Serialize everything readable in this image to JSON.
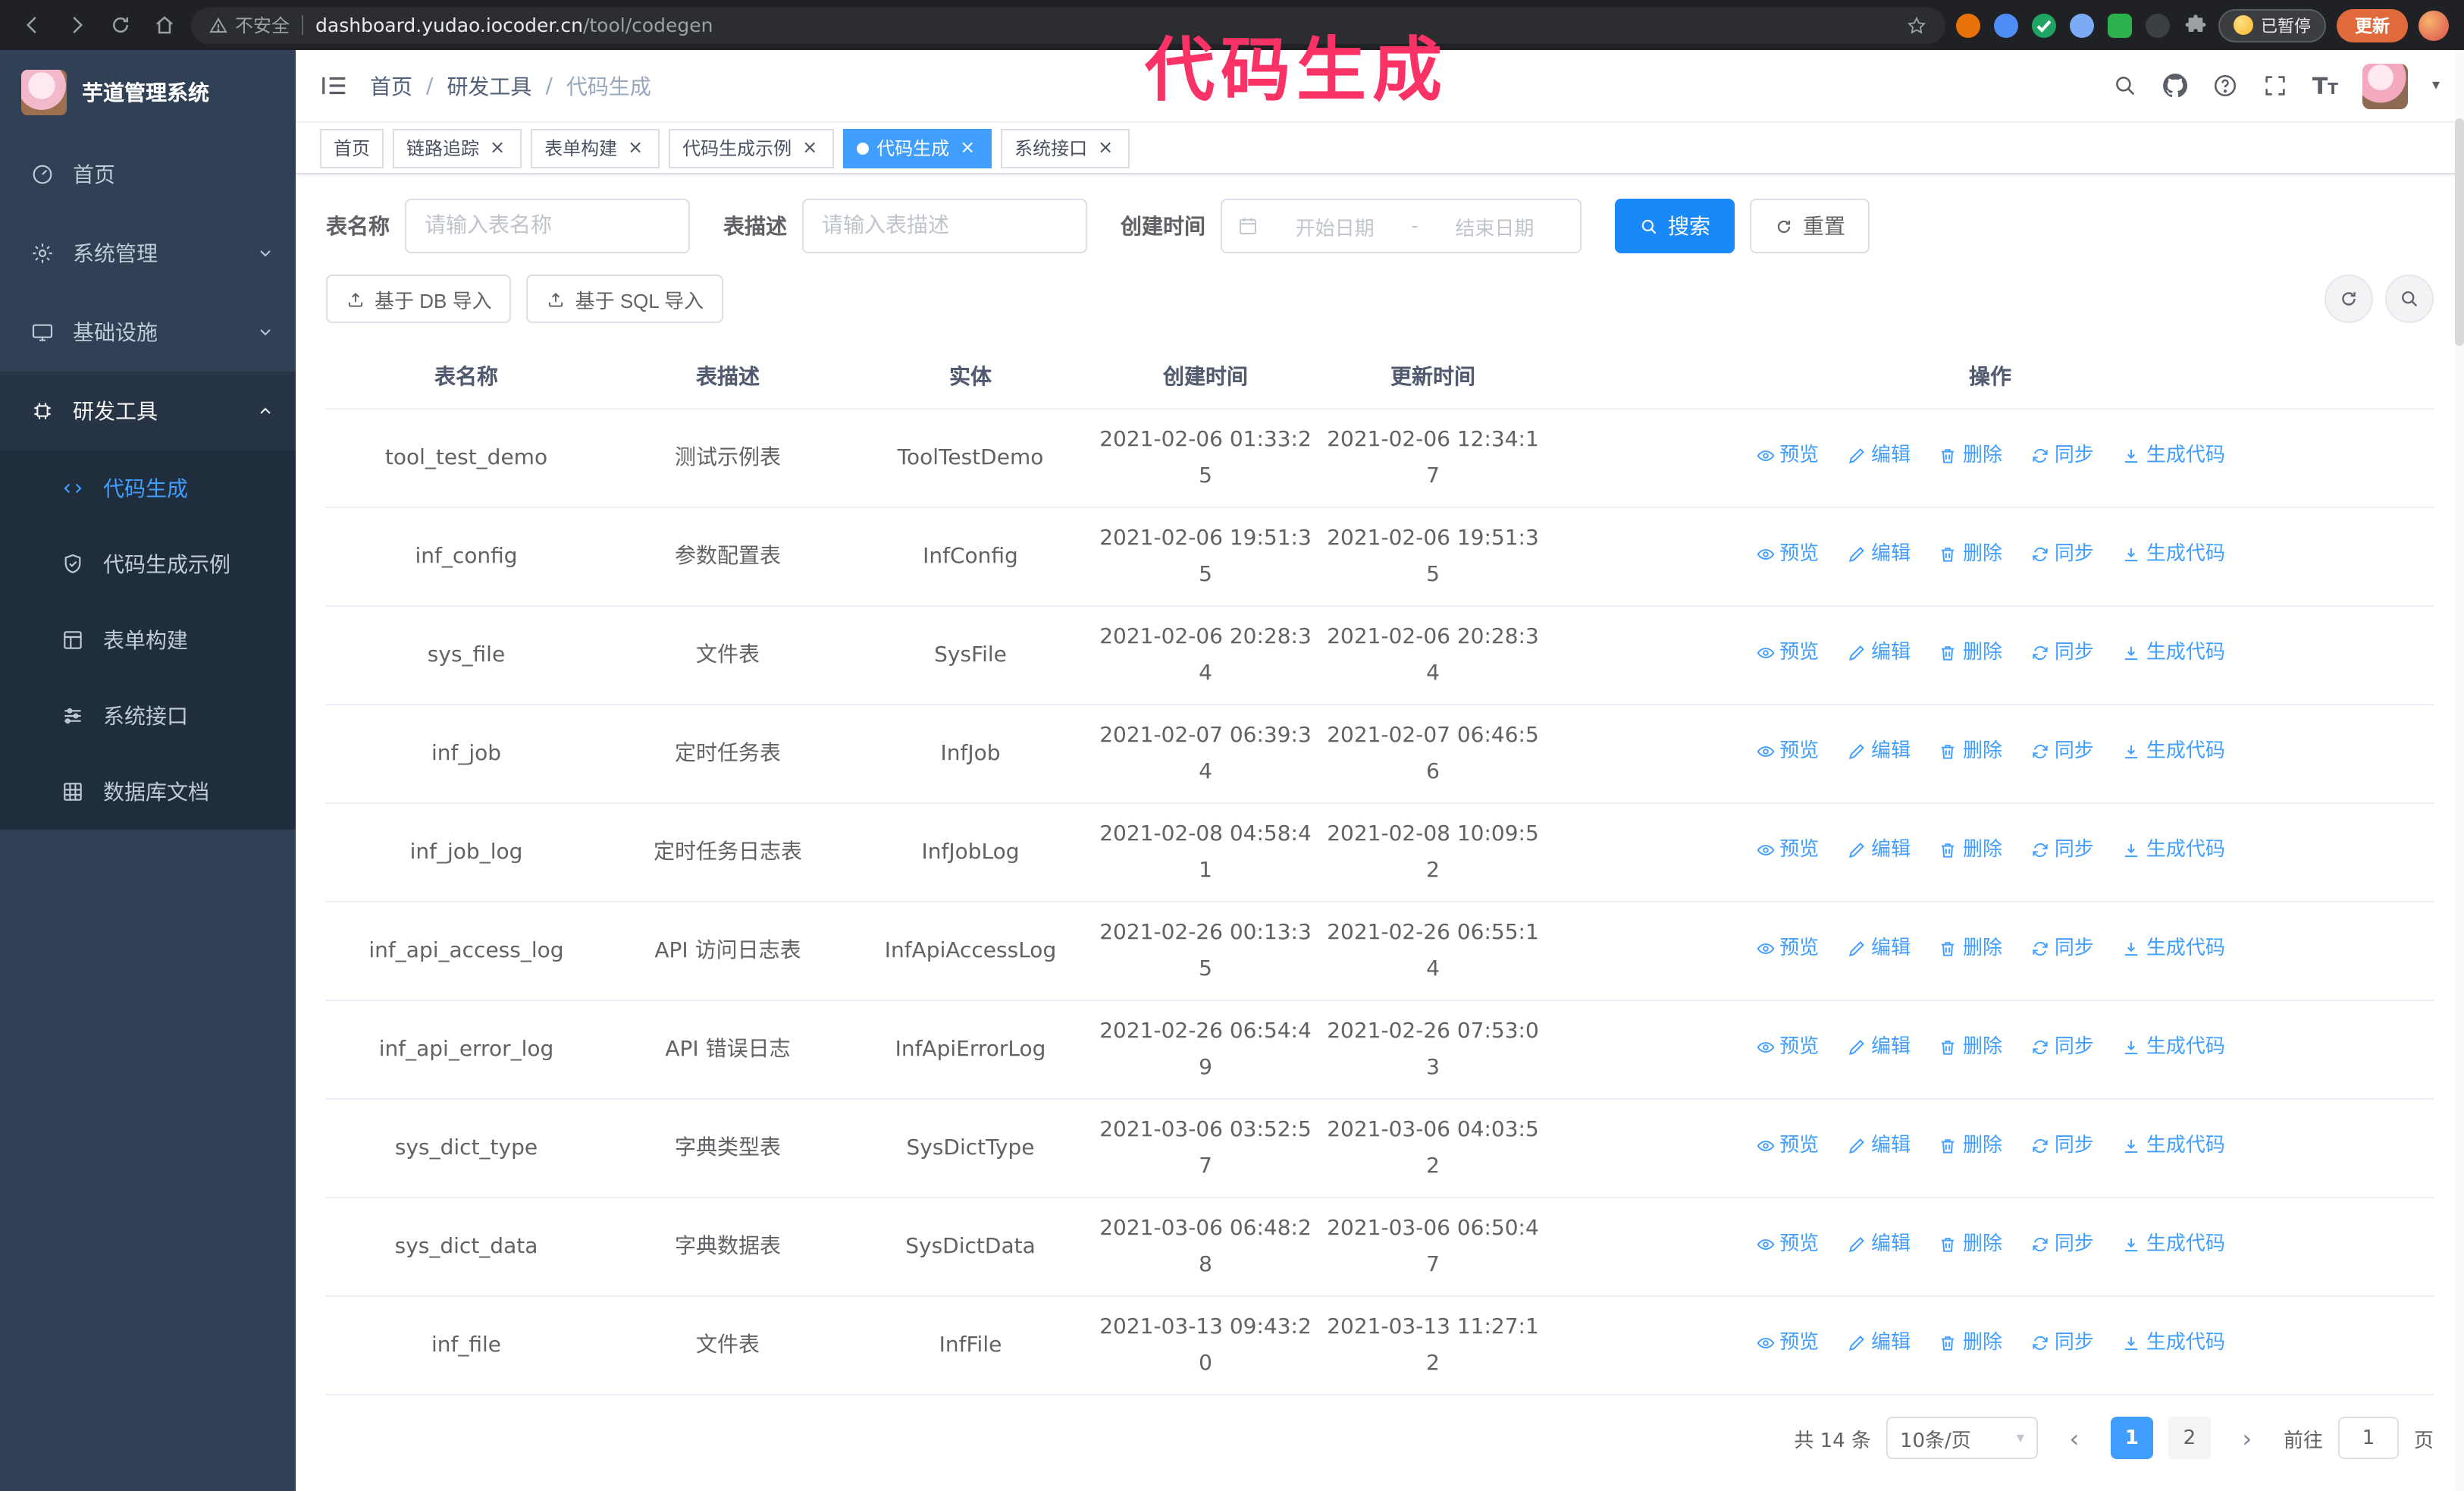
{
  "annotation": {
    "text": "代码生成",
    "color": "#fa3266"
  },
  "browser": {
    "security_label": "不安全",
    "url_domain": "dashboard.yudao.iocoder.cn",
    "url_path": "/tool/codegen",
    "paused_badge": "已暂停",
    "update_button": "更新"
  },
  "sidebar": {
    "logo_title": "芋道管理系统",
    "items": [
      {
        "label": "首页"
      },
      {
        "label": "系统管理"
      },
      {
        "label": "基础设施"
      },
      {
        "label": "研发工具"
      }
    ],
    "submenu": [
      {
        "label": "代码生成",
        "active": true
      },
      {
        "label": "代码生成示例"
      },
      {
        "label": "表单构建"
      },
      {
        "label": "系统接口"
      },
      {
        "label": "数据库文档"
      }
    ]
  },
  "header": {
    "breadcrumb": [
      "首页",
      "研发工具",
      "代码生成"
    ],
    "separator": "/"
  },
  "tabs": [
    {
      "label": "首页",
      "closable": false,
      "active": false
    },
    {
      "label": "链路追踪",
      "closable": true,
      "active": false
    },
    {
      "label": "表单构建",
      "closable": true,
      "active": false
    },
    {
      "label": "代码生成示例",
      "closable": true,
      "active": false
    },
    {
      "label": "代码生成",
      "closable": true,
      "active": true
    },
    {
      "label": "系统接口",
      "closable": true,
      "active": false
    }
  ],
  "filters": {
    "table_name_label": "表名称",
    "table_name_placeholder": "请输入表名称",
    "table_desc_label": "表描述",
    "table_desc_placeholder": "请输入表描述",
    "create_time_label": "创建时间",
    "date_start_placeholder": "开始日期",
    "date_separator": "-",
    "date_end_placeholder": "结束日期",
    "search_button": "搜索",
    "reset_button": "重置"
  },
  "toolbar": {
    "import_db_button": "基于 DB 导入",
    "import_sql_button": "基于 SQL 导入"
  },
  "table": {
    "columns": [
      "表名称",
      "表描述",
      "实体",
      "创建时间",
      "更新时间",
      "操作"
    ],
    "action_labels": [
      "预览",
      "编辑",
      "删除",
      "同步",
      "生成代码"
    ],
    "rows": [
      {
        "name": "tool_test_demo",
        "desc": "测试示例表",
        "entity": "ToolTestDemo",
        "created": "2021-02-06 01:33:25",
        "updated": "2021-02-06 12:34:17"
      },
      {
        "name": "inf_config",
        "desc": "参数配置表",
        "entity": "InfConfig",
        "created": "2021-02-06 19:51:35",
        "updated": "2021-02-06 19:51:35"
      },
      {
        "name": "sys_file",
        "desc": "文件表",
        "entity": "SysFile",
        "created": "2021-02-06 20:28:34",
        "updated": "2021-02-06 20:28:34"
      },
      {
        "name": "inf_job",
        "desc": "定时任务表",
        "entity": "InfJob",
        "created": "2021-02-07 06:39:34",
        "updated": "2021-02-07 06:46:56"
      },
      {
        "name": "inf_job_log",
        "desc": "定时任务日志表",
        "entity": "InfJobLog",
        "created": "2021-02-08 04:58:41",
        "updated": "2021-02-08 10:09:52"
      },
      {
        "name": "inf_api_access_log",
        "desc": "API 访问日志表",
        "entity": "InfApiAccessLog",
        "created": "2021-02-26 00:13:35",
        "updated": "2021-02-26 06:55:14"
      },
      {
        "name": "inf_api_error_log",
        "desc": "API 错误日志",
        "entity": "InfApiErrorLog",
        "created": "2021-02-26 06:54:49",
        "updated": "2021-02-26 07:53:03"
      },
      {
        "name": "sys_dict_type",
        "desc": "字典类型表",
        "entity": "SysDictType",
        "created": "2021-03-06 03:52:57",
        "updated": "2021-03-06 04:03:52"
      },
      {
        "name": "sys_dict_data",
        "desc": "字典数据表",
        "entity": "SysDictData",
        "created": "2021-03-06 06:48:28",
        "updated": "2021-03-06 06:50:47"
      },
      {
        "name": "inf_file",
        "desc": "文件表",
        "entity": "InfFile",
        "created": "2021-03-13 09:43:20",
        "updated": "2021-03-13 11:27:12"
      }
    ]
  },
  "pagination": {
    "total": "共 14 条",
    "page_size": "10条/页",
    "pages": [
      "1",
      "2"
    ],
    "current": "1",
    "goto_label": "前往",
    "goto_value": "1",
    "page_unit": "页"
  },
  "icons": {
    "close": "×",
    "caret_down": "▾",
    "prev": "‹",
    "next": "›",
    "font_size": "T"
  },
  "colors": {
    "accent": "#409eff",
    "primary_button": "#1989fa",
    "sidebar_bg": "#304156"
  }
}
